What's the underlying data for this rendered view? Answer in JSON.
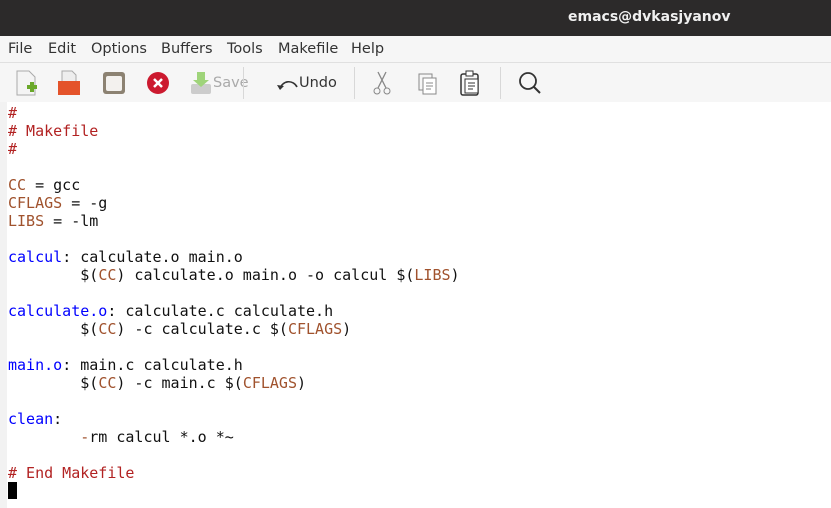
{
  "window": {
    "title": "emacs@dvkasjyanov"
  },
  "menu": [
    "File",
    "Edit",
    "Options",
    "Buffers",
    "Tools",
    "Makefile",
    "Help"
  ],
  "toolbar": {
    "save_label": "Save",
    "undo_label": "Undo",
    "icons": [
      "new-file-icon",
      "open-folder-icon",
      "open-directory-icon",
      "close-buffer-icon",
      "save-icon",
      "undo-icon",
      "cut-icon",
      "copy-icon",
      "paste-icon",
      "search-icon"
    ]
  },
  "colors": {
    "comment": "#b22222",
    "variable": "#a0522d",
    "target": "#0000ff"
  },
  "editor": {
    "lines": [
      [
        [
          "#",
          "c"
        ]
      ],
      [
        [
          "# Makefile",
          "c"
        ]
      ],
      [
        [
          "#",
          "c"
        ]
      ],
      [],
      [
        [
          "CC",
          "v"
        ],
        [
          " = gcc",
          ""
        ]
      ],
      [
        [
          "CFLAGS",
          "v"
        ],
        [
          " = -g",
          ""
        ]
      ],
      [
        [
          "LIBS",
          "v"
        ],
        [
          " = -lm",
          ""
        ]
      ],
      [],
      [
        [
          "calcul",
          "t"
        ],
        [
          ": calculate.o main.o",
          ""
        ]
      ],
      [
        [
          "        $(",
          ""
        ],
        [
          "CC",
          "v"
        ],
        [
          ") calculate.o main.o -o calcul $(",
          ""
        ],
        [
          "LIBS",
          "v"
        ],
        [
          ")",
          ""
        ]
      ],
      [],
      [
        [
          "calculate.o",
          "t"
        ],
        [
          ": calculate.c calculate.h",
          ""
        ]
      ],
      [
        [
          "        $(",
          ""
        ],
        [
          "CC",
          "v"
        ],
        [
          ") -c calculate.c $(",
          ""
        ],
        [
          "CFLAGS",
          "v"
        ],
        [
          ")",
          ""
        ]
      ],
      [],
      [
        [
          "main.o",
          "t"
        ],
        [
          ": main.c calculate.h",
          ""
        ]
      ],
      [
        [
          "        $(",
          ""
        ],
        [
          "CC",
          "v"
        ],
        [
          ") -c main.c $(",
          ""
        ],
        [
          "CFLAGS",
          "v"
        ],
        [
          ")",
          ""
        ]
      ],
      [],
      [
        [
          "clean",
          "t"
        ],
        [
          ":",
          ""
        ]
      ],
      [
        [
          "        ",
          ""
        ],
        [
          "-",
          "v"
        ],
        [
          "rm calcul *.o *~",
          ""
        ]
      ],
      [],
      [
        [
          "# End Makefile",
          "c"
        ]
      ]
    ]
  }
}
